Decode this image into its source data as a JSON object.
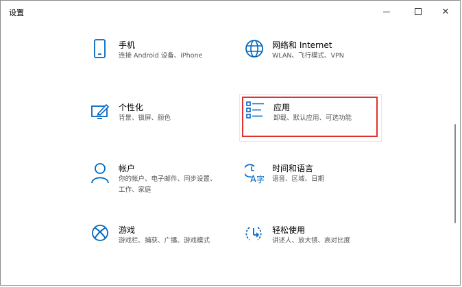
{
  "window": {
    "title": "设置",
    "controls": {
      "minimize": "—",
      "maximize": "□",
      "close": "✕"
    }
  },
  "tiles": [
    {
      "name": "手机",
      "desc": "连接 Android 设备、iPhone",
      "icon": "phone-icon"
    },
    {
      "name": "网络和 Internet",
      "desc": "WLAN、飞行模式、VPN",
      "icon": "globe-icon"
    },
    {
      "name": "个性化",
      "desc": "背景、锁屏、颜色",
      "icon": "personalization-icon"
    },
    {
      "name": "应用",
      "desc": "卸载、默认应用、可选功能",
      "icon": "apps-list-icon",
      "highlighted": true
    },
    {
      "name": "帐户",
      "desc": "你的帐户、电子邮件、同步设置、工作、家庭",
      "icon": "person-icon"
    },
    {
      "name": "时间和语言",
      "desc": "语音、区域、日期",
      "icon": "time-language-icon"
    },
    {
      "name": "游戏",
      "desc": "游戏栏、捕获、广播、游戏模式",
      "icon": "xbox-icon"
    },
    {
      "name": "轻松使用",
      "desc": "讲述人、放大镜、高对比度",
      "icon": "ease-of-access-icon"
    }
  ],
  "colors": {
    "accent": "#0067c0",
    "highlight_border": "#e03131"
  }
}
